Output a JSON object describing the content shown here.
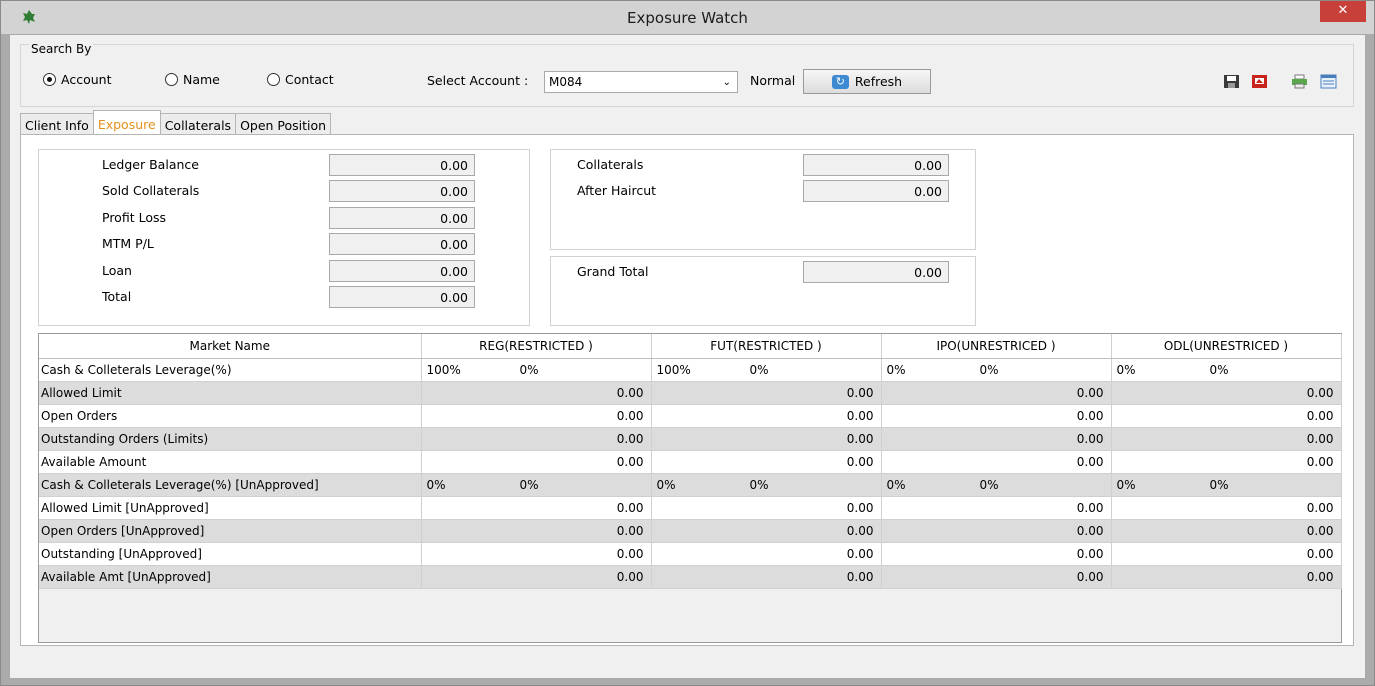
{
  "window": {
    "title": "Exposure Watch",
    "close_label": "✕"
  },
  "search": {
    "group_label": "Search By",
    "radios": [
      {
        "label": "Account",
        "checked": true
      },
      {
        "label": "Name",
        "checked": false
      },
      {
        "label": "Contact",
        "checked": false
      }
    ],
    "select_account_label": "Select Account :",
    "account_value": "M084",
    "mode_label": "Normal",
    "refresh_label": "Refresh"
  },
  "toolbar_icons": [
    "save-icon",
    "pdf-icon",
    "print-icon",
    "grid-view-icon"
  ],
  "tabs": [
    {
      "label": "Client Info",
      "active": false
    },
    {
      "label": "Exposure",
      "active": true
    },
    {
      "label": "Collaterals",
      "active": false
    },
    {
      "label": "Open Position",
      "active": false
    }
  ],
  "left_fields": [
    {
      "label": "Ledger Balance",
      "value": "0.00"
    },
    {
      "label": "Sold Collaterals",
      "value": "0.00"
    },
    {
      "label": "Profit Loss",
      "value": "0.00"
    },
    {
      "label": "MTM P/L",
      "value": "0.00"
    },
    {
      "label": "Loan",
      "value": "0.00"
    },
    {
      "label": "Total",
      "value": "0.00"
    }
  ],
  "right_fields": [
    {
      "label": "Collaterals",
      "value": "0.00"
    },
    {
      "label": "After Haircut",
      "value": "0.00"
    }
  ],
  "grand_total": {
    "label": "Grand Total",
    "value": "0.00"
  },
  "grid": {
    "columns": [
      "Market Name",
      "REG(RESTRICTED )",
      "FUT(RESTRICTED )",
      "IPO(UNRESTRICED )",
      "ODL(UNRESTRICED )"
    ],
    "rows": [
      {
        "name": "Cash & Colleterals Leverage(%)",
        "pair": true,
        "cells": [
          [
            "100%",
            "0%"
          ],
          [
            "100%",
            "0%"
          ],
          [
            "0%",
            "0%"
          ],
          [
            "0%",
            "0%"
          ]
        ]
      },
      {
        "name": "Allowed Limit",
        "cells": [
          "0.00",
          "0.00",
          "0.00",
          "0.00"
        ]
      },
      {
        "name": "Open Orders",
        "cells": [
          "0.00",
          "0.00",
          "0.00",
          "0.00"
        ]
      },
      {
        "name": "Outstanding Orders (Limits)",
        "cells": [
          "0.00",
          "0.00",
          "0.00",
          "0.00"
        ]
      },
      {
        "name": "Available Amount",
        "cells": [
          "0.00",
          "0.00",
          "0.00",
          "0.00"
        ]
      },
      {
        "name": "Cash & Colleterals Leverage(%) [UnApproved]",
        "pair": true,
        "cells": [
          [
            "0%",
            "0%"
          ],
          [
            "0%",
            "0%"
          ],
          [
            "0%",
            "0%"
          ],
          [
            "0%",
            "0%"
          ]
        ]
      },
      {
        "name": "Allowed Limit  [UnApproved]",
        "cells": [
          "0.00",
          "0.00",
          "0.00",
          "0.00"
        ]
      },
      {
        "name": "Open Orders   [UnApproved]",
        "cells": [
          "0.00",
          "0.00",
          "0.00",
          "0.00"
        ]
      },
      {
        "name": "Outstanding      [UnApproved]",
        "cells": [
          "0.00",
          "0.00",
          "0.00",
          "0.00"
        ]
      },
      {
        "name": "Available Amt  [UnApproved]",
        "cells": [
          "0.00",
          "0.00",
          "0.00",
          "0.00"
        ]
      }
    ]
  }
}
